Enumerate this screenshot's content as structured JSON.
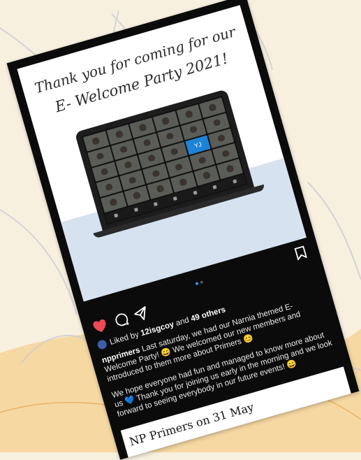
{
  "photo": {
    "line1": "Thank you for coming for our",
    "line2": "E- Welcome Party 2021!",
    "video_tile_label": "YJ"
  },
  "post": {
    "liked_prefix": "Liked by",
    "liked_user": "12isgcoy",
    "liked_and": "and",
    "liked_others": "49 others",
    "username": "npprimers",
    "caption_p1": "Last saturday, we had our Narnia themed E-Welcome Party! 😄 We welcomed our new members and introduced to them more about Primers 😊",
    "caption_p2": "We hope everyone had fun and managed to know more about us 💙 Thank you for joining us early in the morning and we look forward to seeing everybody in our future events! 😄"
  },
  "footer_caption": "NP Primers on 31 May",
  "icons": [
    "heart-icon",
    "comment-icon",
    "share-icon",
    "bookmark-icon"
  ],
  "colors": {
    "background": "#f7f0df",
    "card": "#0b0b0b",
    "heart": "#ed4956",
    "carousel_active": "#3897f0",
    "zoom_tile": "#1d83d6"
  }
}
